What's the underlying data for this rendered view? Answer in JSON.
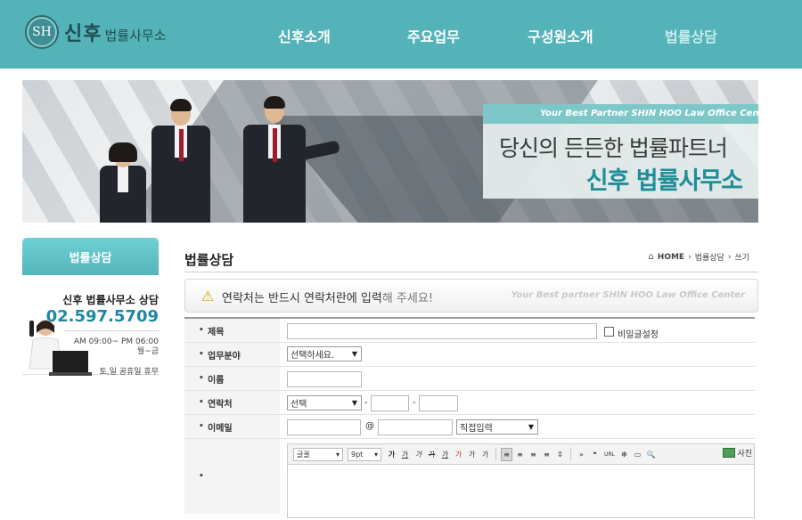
{
  "header": {
    "logo_emblem": "SH",
    "logo_main": "신후",
    "logo_sub": "법률사무소",
    "nav": [
      {
        "label": "신후소개"
      },
      {
        "label": "주요업무"
      },
      {
        "label": "구성원소개"
      },
      {
        "label": "법률상담"
      }
    ]
  },
  "banner": {
    "tagline": "Your Best Partner  SHIN HOO Law Office Center",
    "line1": "당신의 든든한 법률파트너",
    "line2": "신후 법률사무소"
  },
  "sidebar": {
    "tab_label": "법률상담",
    "contact_title": "신후 법률사무소 상담",
    "phone": "02.597.5709",
    "hours_line1": "AM 09:00~ PM 06:00",
    "hours_line2": "월~금",
    "closed": "토,일 공휴일 휴무"
  },
  "content": {
    "title": "법률상담",
    "breadcrumb": [
      "HOME",
      "법률상담",
      "쓰기"
    ],
    "notice_main": "연락처는 반드시 연락처란에 입력",
    "notice_rest": "해 주세요!",
    "notice_en": "Your Best partner SHIN HOO Law Office Center"
  },
  "form": {
    "subject_label": "제목",
    "secret_label": "비밀글설정",
    "field_label": "업무분야",
    "field_selected": "선택하세요.",
    "name_label": "이름",
    "contact_label": "연락처",
    "contact_selected": "선택",
    "dash": "-",
    "email_label": "이메일",
    "email_at": "@",
    "email_domain_selected": "직접입력",
    "editor": {
      "font_select": "글꼴",
      "size_select": "9pt",
      "buttons": [
        "가",
        "가",
        "가",
        "가",
        "가",
        "가",
        "가",
        "가",
        "가",
        "가",
        "가",
        "가",
        "가",
        "가",
        "»",
        "❝",
        "URL",
        "✻",
        "▭",
        "🔍"
      ],
      "photo_label": "사진"
    }
  }
}
